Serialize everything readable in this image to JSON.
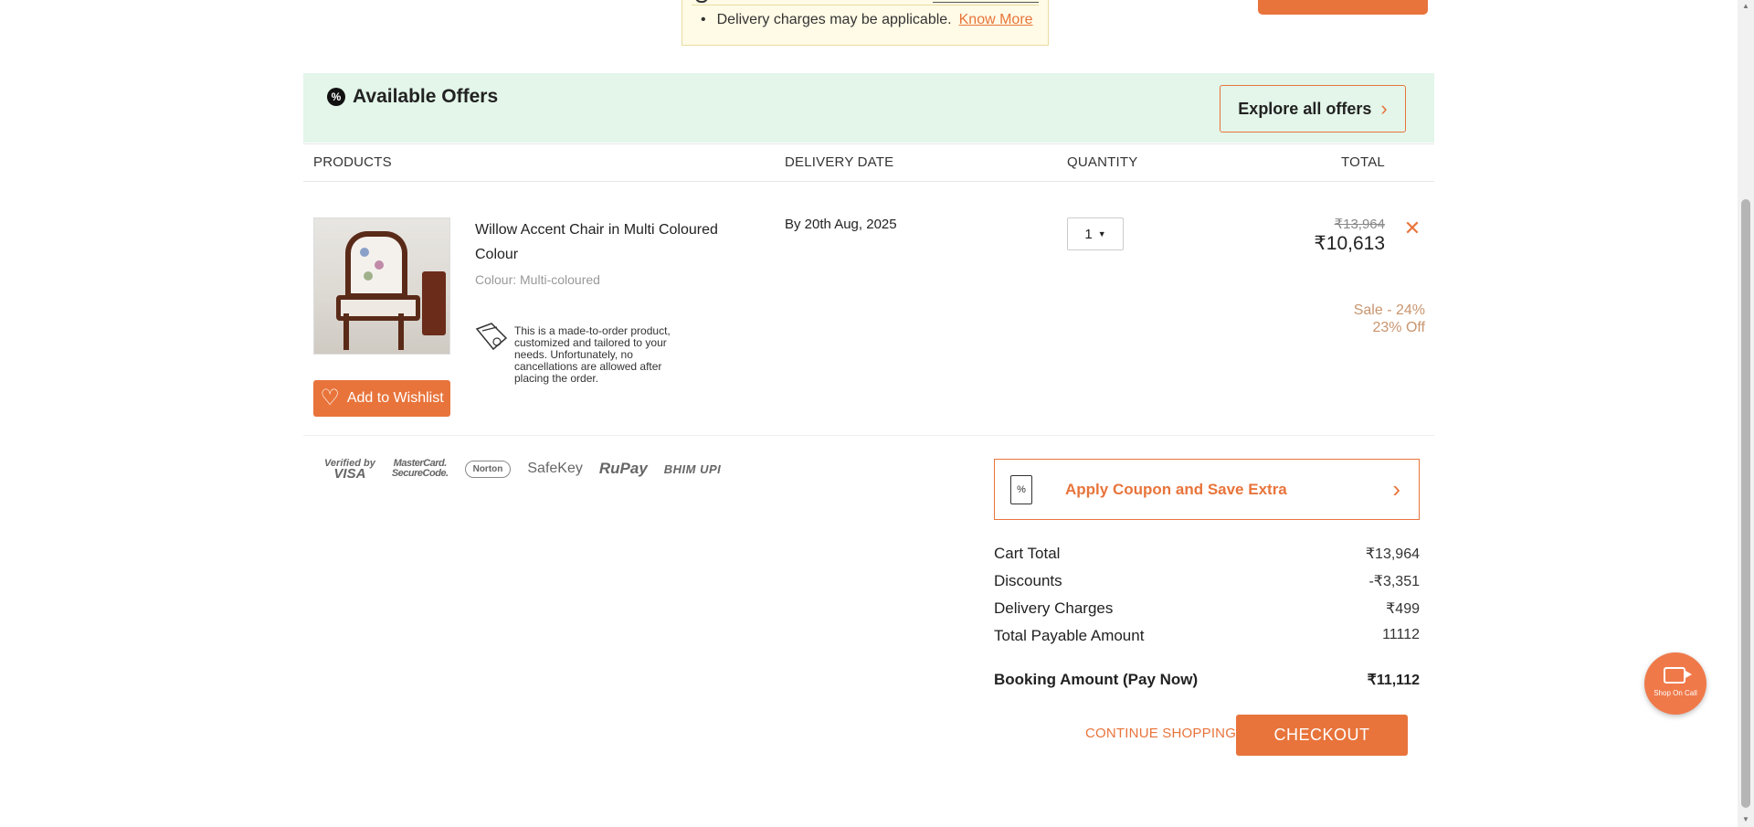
{
  "notice": {
    "text": "Delivery charges may be applicable.",
    "link": "Know More"
  },
  "offers": {
    "title": "Available Offers",
    "explore_label": "Explore all offers"
  },
  "table": {
    "headers": [
      "PRODUCTS",
      "DELIVERY DATE",
      "QUANTITY",
      "TOTAL"
    ]
  },
  "product": {
    "name": "Willow Accent Chair in Multi Coloured Colour",
    "colour": "Colour: Multi-coloured",
    "made_to_order_note": "This is a made-to-order product, customized and tailored to your needs. Unfortunately, no cancellations are allowed after placing the order.",
    "wishlist_label": "Add to Wishlist",
    "delivery_date": "By 20th Aug, 2025",
    "quantity": "1",
    "mrp": "₹13,964",
    "price": "₹10,613",
    "remove_icon": "close-icon",
    "sale_text": "Sale - 24%",
    "off_text": "23% Off"
  },
  "payment_logos": {
    "visa_line1": "Verified by",
    "visa_line2": "VISA",
    "mastercard_line1": "MasterCard.",
    "mastercard_line2": "SecureCode.",
    "norton": "Norton",
    "safekey": "SafeKey",
    "rupay": "RuPay",
    "bhim": "BHIM UPI"
  },
  "coupon": {
    "label": "Apply Coupon and Save Extra"
  },
  "summary": {
    "cart_total_label": "Cart Total",
    "cart_total": "₹13,964",
    "discounts_label": "Discounts",
    "discounts": "-₹3,351",
    "delivery_label": "Delivery Charges",
    "delivery": "₹499",
    "payable_label": "Total Payable Amount",
    "payable": "11112",
    "booking_label": "Booking Amount (Pay Now)",
    "booking": "₹11,112"
  },
  "actions": {
    "continue_label": "CONTINUE SHOPPING",
    "checkout_label": "CHECKOUT"
  },
  "floating": {
    "label": "Shop On Call"
  },
  "colors": {
    "accent": "#e8743b",
    "offers_bg": "#e3f6e9",
    "notice_bg": "#fffbe6"
  }
}
